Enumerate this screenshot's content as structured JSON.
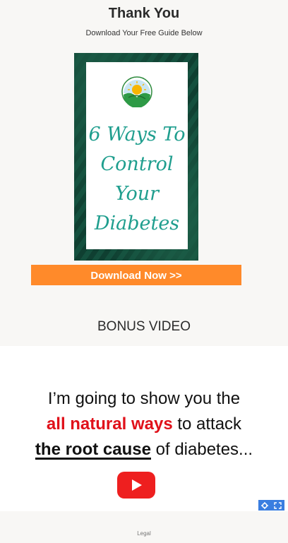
{
  "page": {
    "title": "Thank You",
    "subtitle": "Download Your Free Guide Below"
  },
  "guide": {
    "title_lines": [
      "6 Ways To",
      "Control",
      "Your",
      "Diabetes"
    ],
    "logo_icon": "sun-leaf-logo",
    "accent_color": "#1f9e8e",
    "cover_bg_color": "#0f3f31"
  },
  "download": {
    "label": "Download Now >>",
    "color": "#ff8a2a"
  },
  "bonus": {
    "heading": "BONUS VIDEO",
    "video": {
      "line1": "I’m going to show you the",
      "line2_highlight": "all natural ways",
      "line2_rest": " to attack",
      "line3_underline": "the root cause",
      "line3_rest": " of diabetes...",
      "play_icon": "youtube-play-icon",
      "highlight_color": "#e0111a"
    },
    "controls": {
      "settings_icon": "gear-icon",
      "fullscreen_icon": "fullscreen-icon"
    }
  },
  "footer": {
    "legal": "Legal"
  }
}
